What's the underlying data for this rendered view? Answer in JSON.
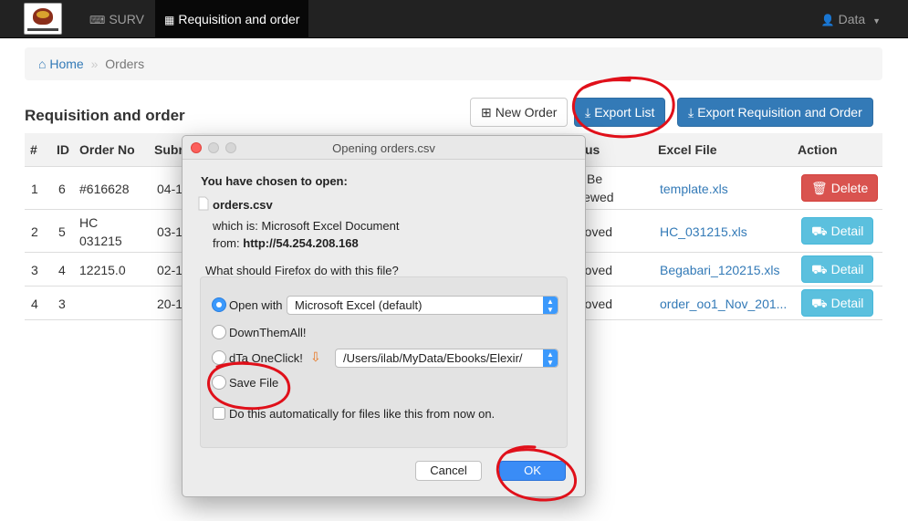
{
  "navbar": {
    "brand_icon": "department-of-health-logo",
    "items": [
      {
        "label": "SURV",
        "icon": "keyboard-icon"
      },
      {
        "label": "Requisition and order",
        "icon": "table-icon"
      }
    ],
    "user_label": "Data"
  },
  "breadcrumb": {
    "home": "Home",
    "separator": "»",
    "current": "Orders"
  },
  "page": {
    "title": "Requisition and order",
    "new_order": "New Order",
    "export_list": "Export List",
    "export_requisition": "Export Requisition and Order"
  },
  "table": {
    "headers": {
      "num": "#",
      "id": "ID",
      "order_no": "Order No",
      "submitted": "Subr",
      "status": "us",
      "excel": "Excel File",
      "action": "Action"
    },
    "rows": [
      {
        "num": "1",
        "id": "6",
        "order_no": "#616628",
        "order_no2": "",
        "submitted": "04-1",
        "status": "Be",
        "status2": "iewed",
        "excel": "template.xls",
        "action": "Delete"
      },
      {
        "num": "2",
        "id": "5",
        "order_no": "HC",
        "order_no2": "031215",
        "submitted": "03-1",
        "status": "roved",
        "status2": "",
        "excel": "HC_031215.xls",
        "action": "Detail"
      },
      {
        "num": "3",
        "id": "4",
        "order_no": "12215.0",
        "order_no2": "",
        "submitted": "02-1",
        "status": "roved",
        "status2": "",
        "excel": "Begabari_120215.xls",
        "action": "Detail"
      },
      {
        "num": "4",
        "id": "3",
        "order_no": "",
        "order_no2": "",
        "submitted": "20-1",
        "status": "roved",
        "status2": "",
        "excel": "order_oo1_Nov_201...",
        "action": "Detail"
      }
    ]
  },
  "dialog": {
    "title": "Opening orders.csv",
    "chosen": "You have chosen to open:",
    "filename": "orders.csv",
    "which_is": "which is:  Microsoft Excel Document",
    "from_label": "from:",
    "from_url": "http://54.254.208.168",
    "question": "What should Firefox do with this file?",
    "open_with_label": "Open with",
    "open_with_value": "Microsoft Excel (default)",
    "downthemall": "DownThemAll!",
    "dta_label": "dTa OneClick!",
    "dta_path": "/Users/ilab/MyData/Ebooks/Elexir/",
    "save_file": "Save File",
    "auto": "Do this automatically for files like this from now on.",
    "cancel": "Cancel",
    "ok": "OK"
  },
  "colors": {
    "annotation": "#e0101a",
    "primary": "#337ab7",
    "danger": "#d9534f",
    "info": "#5bc0de"
  }
}
